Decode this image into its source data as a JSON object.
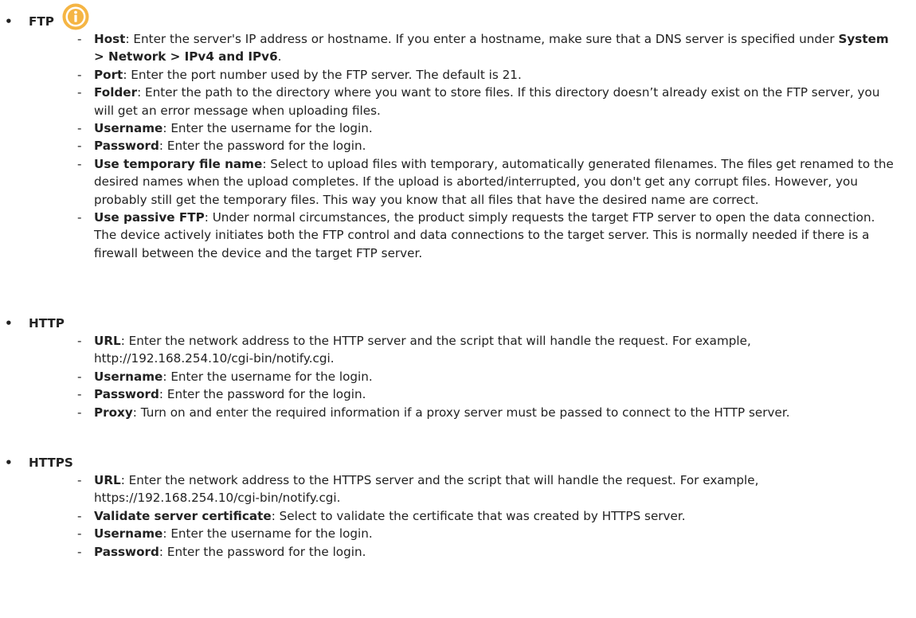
{
  "sections": [
    {
      "title": "FTP",
      "items": [
        {
          "term": "Host",
          "sep": ": ",
          "text": "Enter the server's IP address or hostname. If you enter a hostname, make sure that a DNS server is specified under ",
          "bold2": "System > Network > IPv4 and IPv6",
          "tail": "."
        },
        {
          "term": "Port",
          "sep": ": ",
          "text": "Enter the port number used by the FTP server. The default is 21."
        },
        {
          "term": "Folder",
          "sep": ": ",
          "text": "Enter the path to the directory where you want to store files. If this directory doesn’t already exist on the FTP server, you will get an error message when uploading files."
        },
        {
          "term": "Username",
          "sep": ": ",
          "text": "Enter the username for the login."
        },
        {
          "term": "Password",
          "sep": ": ",
          "text": "Enter the password for the login."
        },
        {
          "term": "Use temporary file name",
          "sep": ": ",
          "text": "Select to upload files with temporary, automatically generated filenames. The files get renamed to the desired names when the upload completes. If the upload is aborted/interrupted, you don't get any corrupt files. However, you probably still get the temporary files. This way you know that all files that have the desired name are correct."
        },
        {
          "term": "Use passive FTP",
          "sep": ": ",
          "text": "Under normal circumstances, the product simply requests the target FTP server to open the data connection. The device actively initiates both the FTP control and data connections to the target server. This is normally needed if there is a firewall between the device and the target FTP server."
        }
      ]
    },
    {
      "title": "HTTP",
      "items": [
        {
          "term": "URL",
          "sep": ": ",
          "text": "Enter the network address to the HTTP server and the script that will handle the request. For example, http://192.168.254.10/cgi-bin/notify.cgi."
        },
        {
          "term": "Username",
          "sep": ": ",
          "text": "Enter the username for the login."
        },
        {
          "term": "Password",
          "sep": ": ",
          "text": "Enter the password for the login."
        },
        {
          "term": "Proxy",
          "sep": ": ",
          "text": "Turn on and enter the required information if a proxy server must be passed to connect to the HTTP server."
        }
      ]
    },
    {
      "title": "HTTPS",
      "items": [
        {
          "term": "URL",
          "sep": ": ",
          "text": "Enter the network address to the HTTPS server and the script that will handle the request. For example, https://192.168.254.10/cgi-bin/notify.cgi."
        },
        {
          "term": "Validate server certificate",
          "sep": ": ",
          "text": "Select to validate the certificate that was created by HTTPS server."
        },
        {
          "term": "Username",
          "sep": ": ",
          "text": "Enter the username for the login."
        },
        {
          "term": "Password",
          "sep": ": ",
          "text": "Enter the password for the login."
        }
      ]
    }
  ],
  "glyphs": {
    "bullet": "•",
    "dash": "-"
  },
  "icons": {
    "info": {
      "name": "info-icon",
      "color": "#f5b544",
      "glyph": "i"
    }
  }
}
